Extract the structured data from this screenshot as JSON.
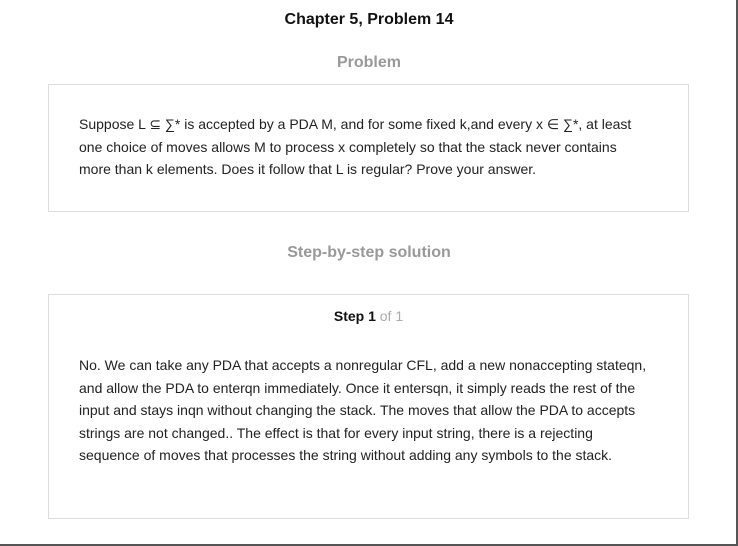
{
  "chapter_title": "Chapter 5, Problem 14",
  "problem": {
    "heading": "Problem",
    "lines": [
      "Suppose L ⊆ ∑* is accepted by a PDA M, and for some fixed k,and every x ∈ ∑*, at least",
      "one choice of moves allows M to process x completely so that the stack never contains",
      "more than k elements. Does it follow that L is regular? Prove your answer."
    ]
  },
  "solution": {
    "heading": "Step-by-step solution",
    "step_label": "Step 1",
    "step_of": "of 1",
    "lines": [
      "No. We can take any PDA that accepts a nonregular CFL, add a new nonaccepting stateqn,",
      "and allow the PDA to enterqn immediately. Once it entersqn, it simply reads the rest of the",
      "input and stays inqn without changing the stack. The moves that allow the PDA to accepts",
      "strings are not changed.. The effect is that for every input string, there is a rejecting",
      "sequence of moves that processes the string without adding any symbols to the stack."
    ]
  }
}
